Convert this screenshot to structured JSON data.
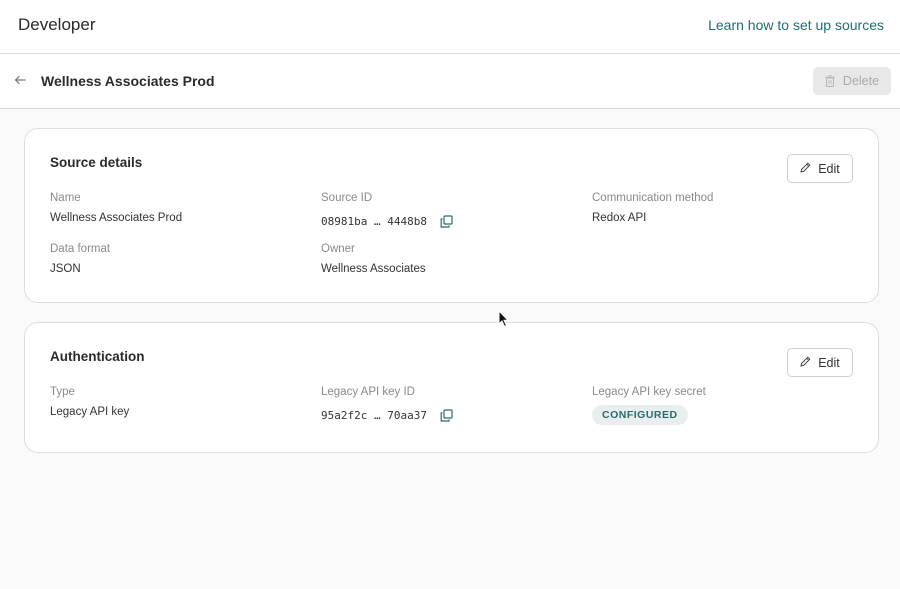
{
  "header": {
    "title": "Developer",
    "learn_link": "Learn how to set up sources"
  },
  "subheader": {
    "source_name": "Wellness Associates Prod",
    "delete_label": "Delete"
  },
  "source_details": {
    "title": "Source details",
    "edit_label": "Edit",
    "name_label": "Name",
    "name_value": "Wellness Associates Prod",
    "source_id_label": "Source ID",
    "source_id_value": "08981ba … 4448b8",
    "comm_label": "Communication method",
    "comm_value": "Redox API",
    "format_label": "Data format",
    "format_value": "JSON",
    "owner_label": "Owner",
    "owner_value": "Wellness Associates"
  },
  "authentication": {
    "title": "Authentication",
    "edit_label": "Edit",
    "type_label": "Type",
    "type_value": "Legacy API key",
    "key_id_label": "Legacy API key ID",
    "key_id_value": "95a2f2c … 70aa37",
    "secret_label": "Legacy API key secret",
    "secret_badge": "CONFIGURED"
  },
  "colors": {
    "accent": "#1f6e72",
    "badge_bg": "#e9efef",
    "badge_text": "#2a6b6b"
  },
  "icons": {
    "back": "arrow-left-icon",
    "delete": "trash-icon",
    "edit": "pencil-icon",
    "copy": "copy-icon",
    "cursor": "mouse-pointer-icon"
  }
}
